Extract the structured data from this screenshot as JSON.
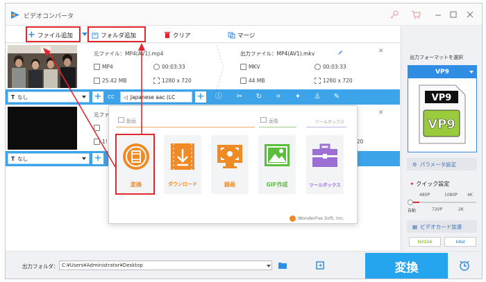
{
  "app": {
    "title": "ビデオコンバータ"
  },
  "toolbar": {
    "add_file": "ファイル追加",
    "add_folder": "フォルダ追加",
    "clear": "クリア",
    "merge": "マージ"
  },
  "file1": {
    "source": "元ファイル：MP4(AV1).mp4",
    "output": "出力ファイル：MP4(AV1).mkv",
    "src_format": "MP4",
    "src_duration": "00:03:33",
    "src_size": "25.42 MB",
    "src_res": "1280 x 720",
    "out_format": "MKV",
    "out_duration": "00:03:33",
    "out_size": "44 MB",
    "out_res": "1280 x 720",
    "subtitle": "なし",
    "audio": "Japanese aac (LC"
  },
  "file2": {
    "source": "元ファイ",
    "size_partial": "1!",
    "res_partial": "720",
    "subtitle": "なし"
  },
  "popup": {
    "tab_video": "動画",
    "tab_image": "画像",
    "tab_tools": "ツールボックス",
    "tiles": [
      "変換",
      "ダウンロード",
      "録画",
      "GIF作成",
      "ツールボックス"
    ],
    "colors": [
      "#f08a24",
      "#f08a24",
      "#f08a24",
      "#5bbd3a",
      "#9b6fd4"
    ],
    "footer": "WonderFox Soft, Inc."
  },
  "right": {
    "format_heading": "出力フォーマットを選択",
    "format": "VP9",
    "param_button": "パラメータ設定",
    "quick": "クイック設定",
    "q480": "480P",
    "q1080": "1080P",
    "q4k": "4K",
    "qauto": "自動",
    "q720": "720P",
    "q2k": "2K",
    "gpu_button": "ビデオカード加速",
    "nvidia": "NVIDIA",
    "intel": "Intel"
  },
  "bottom": {
    "folder_label": "出力フォルダ：",
    "folder_path": "C:¥Users¥Administrator¥Desktop",
    "convert": "変換"
  }
}
